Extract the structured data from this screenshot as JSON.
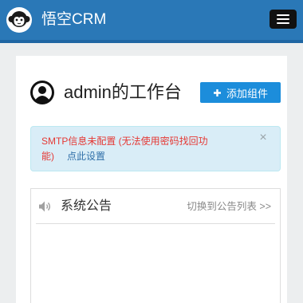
{
  "header": {
    "title": "悟空CRM",
    "logo_icon": "monkey-logo-icon",
    "menu_icon": "hamburger-menu-icon"
  },
  "workbench": {
    "title": "admin的工作台",
    "user_icon": "user-avatar-icon",
    "add_widget_label": "添加组件",
    "add_icon": "plus-icon"
  },
  "alert": {
    "message": "SMTP信息未配置 (无法使用密码找回功能)",
    "link_label": "点此设置",
    "close_label": "×"
  },
  "notice_panel": {
    "title": "系统公告",
    "icon": "speaker-icon",
    "switch_link": "切换到公告列表 >>"
  },
  "colors": {
    "header_bg": "#2a78b7",
    "accent": "#1c8ddb",
    "alert_bg": "#d9edf7",
    "alert_text": "#e53935",
    "link": "#2f6fa8",
    "page_bg": "#eceeef"
  }
}
